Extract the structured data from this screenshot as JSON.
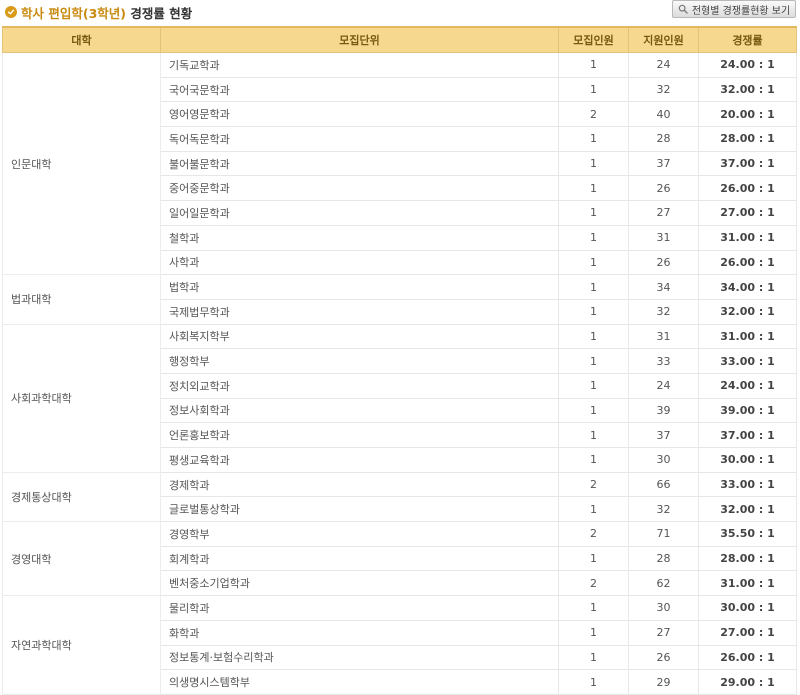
{
  "header": {
    "title_highlight": "학사 편입학(3학년)",
    "title_rest": " 경쟁률 현황",
    "view_button_label": "전형별 경쟁률현황 보기"
  },
  "table": {
    "columns": [
      "대학",
      "모집단위",
      "모집인원",
      "지원인원",
      "경쟁률"
    ],
    "groups": [
      {
        "college": "인문대학",
        "rows": [
          {
            "unit": "기독교학과",
            "quota": "1",
            "applicants": "24",
            "rate": "24.00 : 1"
          },
          {
            "unit": "국어국문학과",
            "quota": "1",
            "applicants": "32",
            "rate": "32.00 : 1"
          },
          {
            "unit": "영어영문학과",
            "quota": "2",
            "applicants": "40",
            "rate": "20.00 : 1"
          },
          {
            "unit": "독어독문학과",
            "quota": "1",
            "applicants": "28",
            "rate": "28.00 : 1"
          },
          {
            "unit": "불어불문학과",
            "quota": "1",
            "applicants": "37",
            "rate": "37.00 : 1"
          },
          {
            "unit": "중어중문학과",
            "quota": "1",
            "applicants": "26",
            "rate": "26.00 : 1"
          },
          {
            "unit": "일어일문학과",
            "quota": "1",
            "applicants": "27",
            "rate": "27.00 : 1"
          },
          {
            "unit": "철학과",
            "quota": "1",
            "applicants": "31",
            "rate": "31.00 : 1"
          },
          {
            "unit": "사학과",
            "quota": "1",
            "applicants": "26",
            "rate": "26.00 : 1"
          }
        ]
      },
      {
        "college": "법과대학",
        "rows": [
          {
            "unit": "법학과",
            "quota": "1",
            "applicants": "34",
            "rate": "34.00 : 1"
          },
          {
            "unit": "국제법무학과",
            "quota": "1",
            "applicants": "32",
            "rate": "32.00 : 1"
          }
        ]
      },
      {
        "college": "사회과학대학",
        "rows": [
          {
            "unit": "사회복지학부",
            "quota": "1",
            "applicants": "31",
            "rate": "31.00 : 1"
          },
          {
            "unit": "행정학부",
            "quota": "1",
            "applicants": "33",
            "rate": "33.00 : 1"
          },
          {
            "unit": "정치외교학과",
            "quota": "1",
            "applicants": "24",
            "rate": "24.00 : 1"
          },
          {
            "unit": "정보사회학과",
            "quota": "1",
            "applicants": "39",
            "rate": "39.00 : 1"
          },
          {
            "unit": "언론홍보학과",
            "quota": "1",
            "applicants": "37",
            "rate": "37.00 : 1"
          },
          {
            "unit": "평생교육학과",
            "quota": "1",
            "applicants": "30",
            "rate": "30.00 : 1"
          }
        ]
      },
      {
        "college": "경제통상대학",
        "rows": [
          {
            "unit": "경제학과",
            "quota": "2",
            "applicants": "66",
            "rate": "33.00 : 1"
          },
          {
            "unit": "글로벌통상학과",
            "quota": "1",
            "applicants": "32",
            "rate": "32.00 : 1"
          }
        ]
      },
      {
        "college": "경영대학",
        "rows": [
          {
            "unit": "경영학부",
            "quota": "2",
            "applicants": "71",
            "rate": "35.50 : 1"
          },
          {
            "unit": "회계학과",
            "quota": "1",
            "applicants": "28",
            "rate": "28.00 : 1"
          },
          {
            "unit": "벤처중소기업학과",
            "quota": "2",
            "applicants": "62",
            "rate": "31.00 : 1"
          }
        ]
      },
      {
        "college": "자연과학대학",
        "rows": [
          {
            "unit": "물리학과",
            "quota": "1",
            "applicants": "30",
            "rate": "30.00 : 1"
          },
          {
            "unit": "화학과",
            "quota": "1",
            "applicants": "27",
            "rate": "27.00 : 1"
          },
          {
            "unit": "정보통계·보험수리학과",
            "quota": "1",
            "applicants": "26",
            "rate": "26.00 : 1"
          },
          {
            "unit": "의생명시스템학부",
            "quota": "1",
            "applicants": "29",
            "rate": "29.00 : 1"
          }
        ]
      }
    ]
  }
}
